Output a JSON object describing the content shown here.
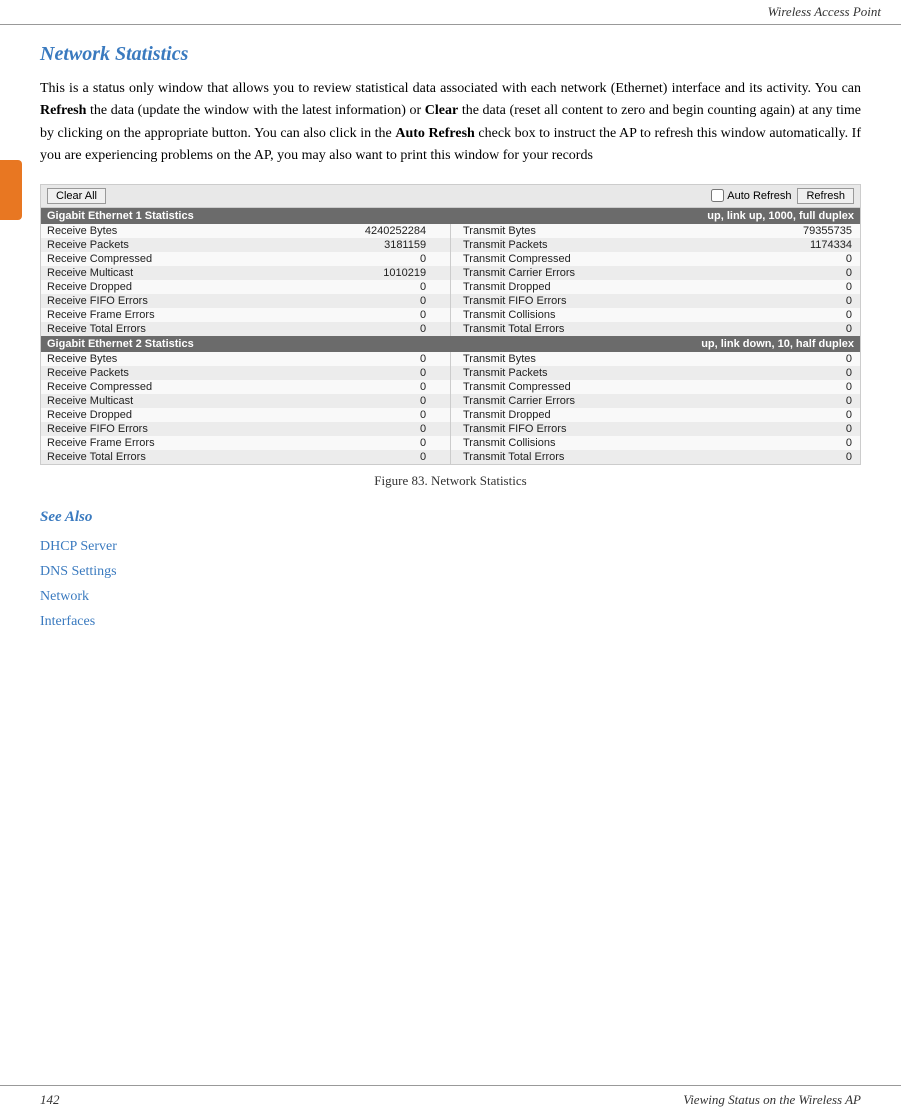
{
  "header": {
    "title": "Wireless Access Point"
  },
  "page": {
    "title": "Network Statistics",
    "body_parts": [
      "This is a status only window that allows you to review statistical data associated with each network (Ethernet) interface and its activity. You can ",
      "Refresh",
      " the data (update the window with the latest information) or ",
      "Clear",
      " the data (reset all content to zero and begin counting again) at any time by clicking on the appropriate button. You can also click in the ",
      "Auto Refresh",
      " check box to instruct the AP to refresh this window automatically. If you are experiencing problems on the AP, you may also want to print this window for your records"
    ]
  },
  "screenshot": {
    "clear_all_label": "Clear All",
    "auto_refresh_label": "Auto Refresh",
    "refresh_label": "Refresh",
    "section1": {
      "title": "Gigabit Ethernet 1 Statistics",
      "status": "up, link up, 1000, full duplex",
      "rows": [
        {
          "left_label": "Receive Bytes",
          "left_value": "4240252284",
          "right_label": "Transmit Bytes",
          "right_value": "79355735"
        },
        {
          "left_label": "Receive Packets",
          "left_value": "3181159",
          "right_label": "Transmit Packets",
          "right_value": "1174334"
        },
        {
          "left_label": "Receive Compressed",
          "left_value": "0",
          "right_label": "Transmit Compressed",
          "right_value": "0"
        },
        {
          "left_label": "Receive Multicast",
          "left_value": "1010219",
          "right_label": "Transmit Carrier Errors",
          "right_value": "0"
        },
        {
          "left_label": "Receive Dropped",
          "left_value": "0",
          "right_label": "Transmit Dropped",
          "right_value": "0"
        },
        {
          "left_label": "Receive FIFO Errors",
          "left_value": "0",
          "right_label": "Transmit FIFO Errors",
          "right_value": "0"
        },
        {
          "left_label": "Receive Frame Errors",
          "left_value": "0",
          "right_label": "Transmit Collisions",
          "right_value": "0"
        },
        {
          "left_label": "Receive Total Errors",
          "left_value": "0",
          "right_label": "Transmit Total Errors",
          "right_value": "0"
        }
      ]
    },
    "section2": {
      "title": "Gigabit Ethernet 2 Statistics",
      "status": "up, link down, 10, half duplex",
      "rows": [
        {
          "left_label": "Receive Bytes",
          "left_value": "0",
          "right_label": "Transmit Bytes",
          "right_value": "0"
        },
        {
          "left_label": "Receive Packets",
          "left_value": "0",
          "right_label": "Transmit Packets",
          "right_value": "0"
        },
        {
          "left_label": "Receive Compressed",
          "left_value": "0",
          "right_label": "Transmit Compressed",
          "right_value": "0"
        },
        {
          "left_label": "Receive Multicast",
          "left_value": "0",
          "right_label": "Transmit Carrier Errors",
          "right_value": "0"
        },
        {
          "left_label": "Receive Dropped",
          "left_value": "0",
          "right_label": "Transmit Dropped",
          "right_value": "0"
        },
        {
          "left_label": "Receive FIFO Errors",
          "left_value": "0",
          "right_label": "Transmit FIFO Errors",
          "right_value": "0"
        },
        {
          "left_label": "Receive Frame Errors",
          "left_value": "0",
          "right_label": "Transmit Collisions",
          "right_value": "0"
        },
        {
          "left_label": "Receive Total Errors",
          "left_value": "0",
          "right_label": "Transmit Total Errors",
          "right_value": "0"
        }
      ]
    }
  },
  "figure_caption": "Figure 83. Network Statistics",
  "see_also": {
    "title": "See Also",
    "links": [
      "DHCP Server",
      "DNS Settings",
      "Network",
      "Interfaces"
    ]
  },
  "footer": {
    "page_number": "142",
    "section": "Viewing Status on the Wireless AP"
  }
}
